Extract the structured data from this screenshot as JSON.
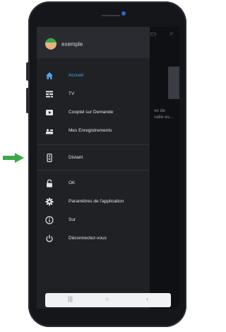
{
  "profile": {
    "username": "exemple"
  },
  "menu": [
    {
      "label": "Accueil",
      "icon": "home-icon",
      "active": true
    },
    {
      "label": "TV",
      "icon": "tv-guide-icon"
    },
    {
      "label": "Cooptel sur Demande",
      "icon": "play-icon"
    },
    {
      "label": "Mes Enregistrements",
      "icon": "recordings-icon"
    },
    {
      "label": "Distant",
      "icon": "remote-icon"
    },
    {
      "label": "OK",
      "icon": "lock-icon"
    },
    {
      "label": "Paramètres de l'application",
      "icon": "gear-icon"
    },
    {
      "label": "Sur",
      "icon": "info-icon"
    },
    {
      "label": "Déconnectez-vous",
      "icon": "power-icon"
    }
  ],
  "underlay": {
    "line1": "ve de",
    "line2": "valle es..."
  },
  "navbar": {
    "recents": "|||",
    "home": "○",
    "back": "‹"
  },
  "colors": {
    "accent": "#4ea6e9",
    "arrow": "#3aaa4a"
  }
}
